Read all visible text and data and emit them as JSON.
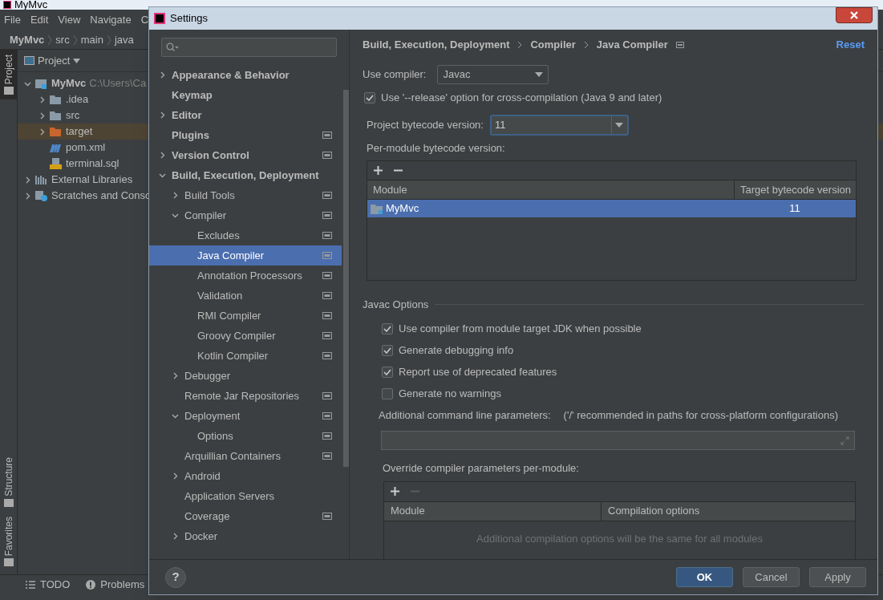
{
  "ide": {
    "title": "MyMvc",
    "menu": [
      "File",
      "Edit",
      "View",
      "Navigate",
      "C"
    ],
    "breadcrumb": [
      "MyMvc",
      "src",
      "main",
      "java"
    ],
    "side_tabs": [
      {
        "label": "Project",
        "selected": true
      },
      {
        "label": "Structure",
        "selected": false
      },
      {
        "label": "Favorites",
        "selected": false
      }
    ],
    "project_panel": {
      "title": "Project",
      "tree": [
        {
          "kind": "module",
          "label": "MyMvc",
          "detail": "C:\\Users\\Ca",
          "expanded": true,
          "selected": false,
          "children": [
            {
              "kind": "folder",
              "label": ".idea",
              "expanded": false,
              "selected": false
            },
            {
              "kind": "folder",
              "label": "src",
              "expanded": false,
              "selected": false
            },
            {
              "kind": "excluded-folder",
              "label": "target",
              "expanded": false,
              "selected": true
            },
            {
              "kind": "maven",
              "label": "pom.xml",
              "selected": false
            },
            {
              "kind": "sql",
              "label": "terminal.sql",
              "selected": false
            }
          ]
        },
        {
          "kind": "libraries",
          "label": "External Libraries",
          "expanded": false,
          "selected": false
        },
        {
          "kind": "scratches",
          "label": "Scratches and Consc",
          "expanded": false,
          "selected": false
        }
      ]
    },
    "bottom_tabs": [
      {
        "kind": "todo",
        "label": "TODO"
      },
      {
        "kind": "problems",
        "label": "Problems"
      }
    ]
  },
  "dialog": {
    "title": "Settings",
    "tree": [
      {
        "label": "Appearance & Behavior",
        "expanded": false,
        "project_level": false,
        "selected": false
      },
      {
        "label": "Keymap",
        "project_level": false,
        "selected": false
      },
      {
        "label": "Editor",
        "expanded": false,
        "project_level": false,
        "selected": false
      },
      {
        "label": "Plugins",
        "project_level": true,
        "selected": false
      },
      {
        "label": "Version Control",
        "expanded": false,
        "project_level": true,
        "selected": false
      },
      {
        "label": "Build, Execution, Deployment",
        "expanded": true,
        "project_level": false,
        "selected": false,
        "children": [
          {
            "label": "Build Tools",
            "expanded": false,
            "project_level": true,
            "selected": false
          },
          {
            "label": "Compiler",
            "expanded": true,
            "project_level": true,
            "selected": false,
            "children": [
              {
                "label": "Excludes",
                "project_level": true,
                "selected": false
              },
              {
                "label": "Java Compiler",
                "project_level": true,
                "selected": true
              },
              {
                "label": "Annotation Processors",
                "project_level": true,
                "selected": false
              },
              {
                "label": "Validation",
                "project_level": true,
                "selected": false
              },
              {
                "label": "RMI Compiler",
                "project_level": true,
                "selected": false
              },
              {
                "label": "Groovy Compiler",
                "project_level": true,
                "selected": false
              },
              {
                "label": "Kotlin Compiler",
                "project_level": true,
                "selected": false
              }
            ]
          },
          {
            "label": "Debugger",
            "expanded": false,
            "project_level": false,
            "selected": false
          },
          {
            "label": "Remote Jar Repositories",
            "project_level": true,
            "selected": false
          },
          {
            "label": "Deployment",
            "expanded": true,
            "project_level": true,
            "selected": false,
            "children": [
              {
                "label": "Options",
                "project_level": true,
                "selected": false
              }
            ]
          },
          {
            "label": "Arquillian Containers",
            "project_level": true,
            "selected": false
          },
          {
            "label": "Android",
            "expanded": false,
            "project_level": false,
            "selected": false
          },
          {
            "label": "Application Servers",
            "project_level": false,
            "selected": false
          },
          {
            "label": "Coverage",
            "project_level": true,
            "selected": false
          },
          {
            "label": "Docker",
            "expanded": false,
            "project_level": false,
            "selected": false
          }
        ]
      }
    ],
    "breadcrumb": [
      "Build, Execution, Deployment",
      "Compiler",
      "Java Compiler"
    ],
    "reset": "Reset",
    "use_compiler": {
      "label": "Use compiler:",
      "value": "Javac"
    },
    "release_option": {
      "label": "Use '--release' option for cross-compilation (Java 9 and later)",
      "checked": true
    },
    "project_bytecode": {
      "label": "Project bytecode version:",
      "value": "11"
    },
    "per_module": {
      "label": "Per-module bytecode version:",
      "columns": [
        "Module",
        "Target bytecode version"
      ],
      "rows": [
        {
          "module": "MyMvc",
          "version": "11",
          "selected": true
        }
      ]
    },
    "javac_options": {
      "title": "Javac Options",
      "options": [
        {
          "label": "Use compiler from module target JDK when possible",
          "checked": true
        },
        {
          "label": "Generate debugging info",
          "checked": true
        },
        {
          "label": "Report use of deprecated features",
          "checked": true
        },
        {
          "label": "Generate no warnings",
          "checked": false
        }
      ],
      "params_label": "Additional command line parameters:",
      "params_hint": "('/' recommended in paths for cross-platform configurations)",
      "override_label": "Override compiler parameters per-module:",
      "override_columns": [
        "Module",
        "Compilation options"
      ],
      "override_empty": "Additional compilation options will be the same for all modules"
    },
    "buttons": [
      {
        "label": "OK",
        "primary": true
      },
      {
        "label": "Cancel",
        "primary": false
      },
      {
        "label": "Apply",
        "primary": false
      }
    ],
    "help": "?"
  }
}
